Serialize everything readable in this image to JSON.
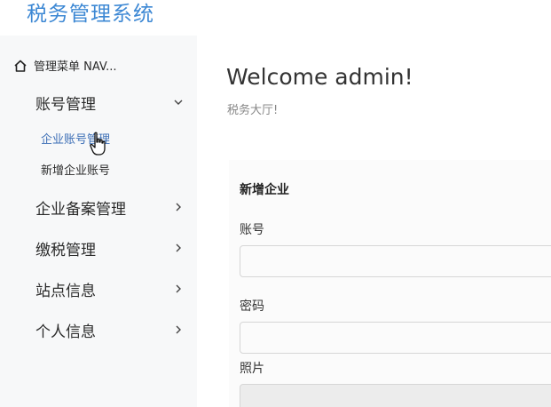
{
  "app": {
    "brand": "税务管理系统"
  },
  "sidebar": {
    "nav_title": "管理菜单 NAV...",
    "menus": [
      {
        "label": "账号管理",
        "expanded": true,
        "children": [
          {
            "label": "企业账号管理",
            "active": true
          },
          {
            "label": "新增企业账号",
            "active": false
          }
        ]
      },
      {
        "label": "企业备案管理",
        "expanded": false
      },
      {
        "label": "缴税管理",
        "expanded": false
      },
      {
        "label": "站点信息",
        "expanded": false
      },
      {
        "label": "个人信息",
        "expanded": false
      }
    ]
  },
  "main": {
    "welcome": "Welcome admin!",
    "subtitle": "税务大厅!",
    "form": {
      "title": "新增企业",
      "account_label": "账号",
      "account_value": "",
      "password_label": "密码",
      "password_value": "",
      "photo_label": "照片"
    }
  },
  "colors": {
    "brand": "#3d88d4",
    "active_link": "#3d6fb6",
    "sidebar_bg": "#f7f8f9"
  }
}
